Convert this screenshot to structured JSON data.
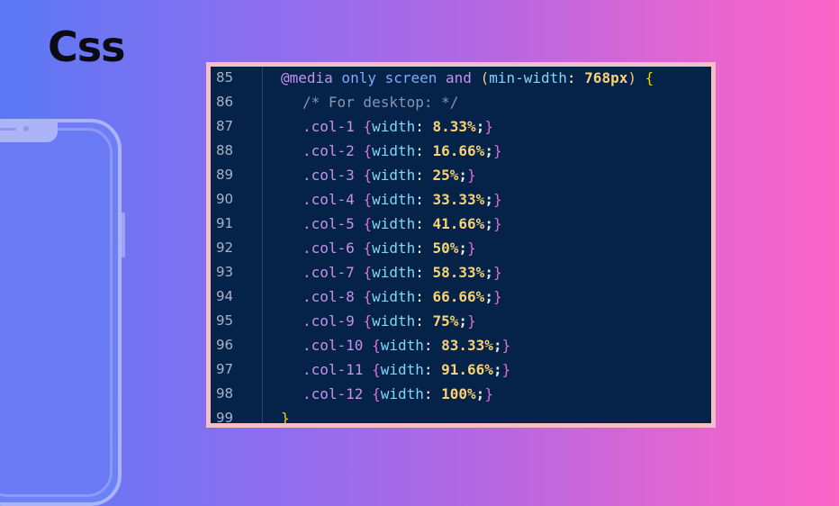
{
  "page": {
    "title": "Css"
  },
  "editor": {
    "lines": [
      {
        "number": "85",
        "parts": [
          {
            "t": "@media",
            "c": "kw"
          },
          {
            "t": " only screen ",
            "c": "kw2"
          },
          {
            "t": "and",
            "c": "kw"
          },
          {
            "t": " (",
            "c": "paren"
          },
          {
            "t": "min-width",
            "c": "prop"
          },
          {
            "t": ": ",
            "c": "highlight"
          },
          {
            "t": "768px",
            "c": "num"
          },
          {
            "t": ")",
            "c": "paren"
          },
          {
            "t": " {",
            "c": "brace0"
          }
        ],
        "indent": 1
      },
      {
        "number": "86",
        "parts": [
          {
            "t": "/* For desktop: */",
            "c": "cmt"
          }
        ],
        "indent": 2
      },
      {
        "number": "87",
        "parts": [
          {
            "t": ".col-1 ",
            "c": "sel"
          },
          {
            "t": "{",
            "c": "brace1"
          },
          {
            "t": "width",
            "c": "prop"
          },
          {
            "t": ": ",
            "c": "highlight"
          },
          {
            "t": "8.33%",
            "c": "num"
          },
          {
            "t": ";",
            "c": "semi"
          },
          {
            "t": "}",
            "c": "brace1"
          }
        ],
        "indent": 2
      },
      {
        "number": "88",
        "parts": [
          {
            "t": ".col-2 ",
            "c": "sel"
          },
          {
            "t": "{",
            "c": "brace1"
          },
          {
            "t": "width",
            "c": "prop"
          },
          {
            "t": ": ",
            "c": "highlight"
          },
          {
            "t": "16.66%",
            "c": "num"
          },
          {
            "t": ";",
            "c": "semi"
          },
          {
            "t": "}",
            "c": "brace1"
          }
        ],
        "indent": 2
      },
      {
        "number": "89",
        "parts": [
          {
            "t": ".col-3 ",
            "c": "sel"
          },
          {
            "t": "{",
            "c": "brace1"
          },
          {
            "t": "width",
            "c": "prop"
          },
          {
            "t": ": ",
            "c": "highlight"
          },
          {
            "t": "25%",
            "c": "num"
          },
          {
            "t": ";",
            "c": "semi"
          },
          {
            "t": "}",
            "c": "brace1"
          }
        ],
        "indent": 2
      },
      {
        "number": "90",
        "parts": [
          {
            "t": ".col-4 ",
            "c": "sel"
          },
          {
            "t": "{",
            "c": "brace1"
          },
          {
            "t": "width",
            "c": "prop"
          },
          {
            "t": ": ",
            "c": "highlight"
          },
          {
            "t": "33.33%",
            "c": "num"
          },
          {
            "t": ";",
            "c": "semi"
          },
          {
            "t": "}",
            "c": "brace1"
          }
        ],
        "indent": 2
      },
      {
        "number": "91",
        "parts": [
          {
            "t": ".col-5 ",
            "c": "sel"
          },
          {
            "t": "{",
            "c": "brace1"
          },
          {
            "t": "width",
            "c": "prop"
          },
          {
            "t": ": ",
            "c": "highlight"
          },
          {
            "t": "41.66%",
            "c": "num"
          },
          {
            "t": ";",
            "c": "semi"
          },
          {
            "t": "}",
            "c": "brace1"
          }
        ],
        "indent": 2
      },
      {
        "number": "92",
        "parts": [
          {
            "t": ".col-6 ",
            "c": "sel"
          },
          {
            "t": "{",
            "c": "brace1"
          },
          {
            "t": "width",
            "c": "prop"
          },
          {
            "t": ": ",
            "c": "highlight"
          },
          {
            "t": "50%",
            "c": "num"
          },
          {
            "t": ";",
            "c": "semi"
          },
          {
            "t": "}",
            "c": "brace1"
          }
        ],
        "indent": 2
      },
      {
        "number": "93",
        "parts": [
          {
            "t": ".col-7 ",
            "c": "sel"
          },
          {
            "t": "{",
            "c": "brace1"
          },
          {
            "t": "width",
            "c": "prop"
          },
          {
            "t": ": ",
            "c": "highlight"
          },
          {
            "t": "58.33%",
            "c": "num"
          },
          {
            "t": ";",
            "c": "semi"
          },
          {
            "t": "}",
            "c": "brace1"
          }
        ],
        "indent": 2
      },
      {
        "number": "94",
        "parts": [
          {
            "t": ".col-8 ",
            "c": "sel"
          },
          {
            "t": "{",
            "c": "brace1"
          },
          {
            "t": "width",
            "c": "prop"
          },
          {
            "t": ": ",
            "c": "highlight"
          },
          {
            "t": "66.66%",
            "c": "num"
          },
          {
            "t": ";",
            "c": "semi"
          },
          {
            "t": "}",
            "c": "brace1"
          }
        ],
        "indent": 2
      },
      {
        "number": "95",
        "parts": [
          {
            "t": ".col-9 ",
            "c": "sel"
          },
          {
            "t": "{",
            "c": "brace1"
          },
          {
            "t": "width",
            "c": "prop"
          },
          {
            "t": ": ",
            "c": "highlight"
          },
          {
            "t": "75%",
            "c": "num"
          },
          {
            "t": ";",
            "c": "semi"
          },
          {
            "t": "}",
            "c": "brace1"
          }
        ],
        "indent": 2
      },
      {
        "number": "96",
        "parts": [
          {
            "t": ".col-10 ",
            "c": "sel"
          },
          {
            "t": "{",
            "c": "brace1"
          },
          {
            "t": "width",
            "c": "prop"
          },
          {
            "t": ": ",
            "c": "highlight"
          },
          {
            "t": "83.33%",
            "c": "num"
          },
          {
            "t": ";",
            "c": "semi"
          },
          {
            "t": "}",
            "c": "brace1"
          }
        ],
        "indent": 2
      },
      {
        "number": "97",
        "parts": [
          {
            "t": ".col-11 ",
            "c": "sel"
          },
          {
            "t": "{",
            "c": "brace1"
          },
          {
            "t": "width",
            "c": "prop"
          },
          {
            "t": ": ",
            "c": "highlight"
          },
          {
            "t": "91.66%",
            "c": "num"
          },
          {
            "t": ";",
            "c": "semi"
          },
          {
            "t": "}",
            "c": "brace1"
          }
        ],
        "indent": 2
      },
      {
        "number": "98",
        "parts": [
          {
            "t": ".col-12 ",
            "c": "sel"
          },
          {
            "t": "{",
            "c": "brace1"
          },
          {
            "t": "width",
            "c": "prop"
          },
          {
            "t": ": ",
            "c": "highlight"
          },
          {
            "t": "100%",
            "c": "num"
          },
          {
            "t": ";",
            "c": "semi"
          },
          {
            "t": "}",
            "c": "brace1"
          }
        ],
        "indent": 2
      },
      {
        "number": "99",
        "parts": [
          {
            "t": "}",
            "c": "brace0"
          }
        ],
        "indent": 1
      }
    ]
  },
  "colors": {
    "background_left": "#5b78f5",
    "background_right": "#fb66c8",
    "editor_background": "#052249",
    "editor_border": "#f6bfc6"
  },
  "icons": {
    "phone": "phone-mockup-icon"
  }
}
